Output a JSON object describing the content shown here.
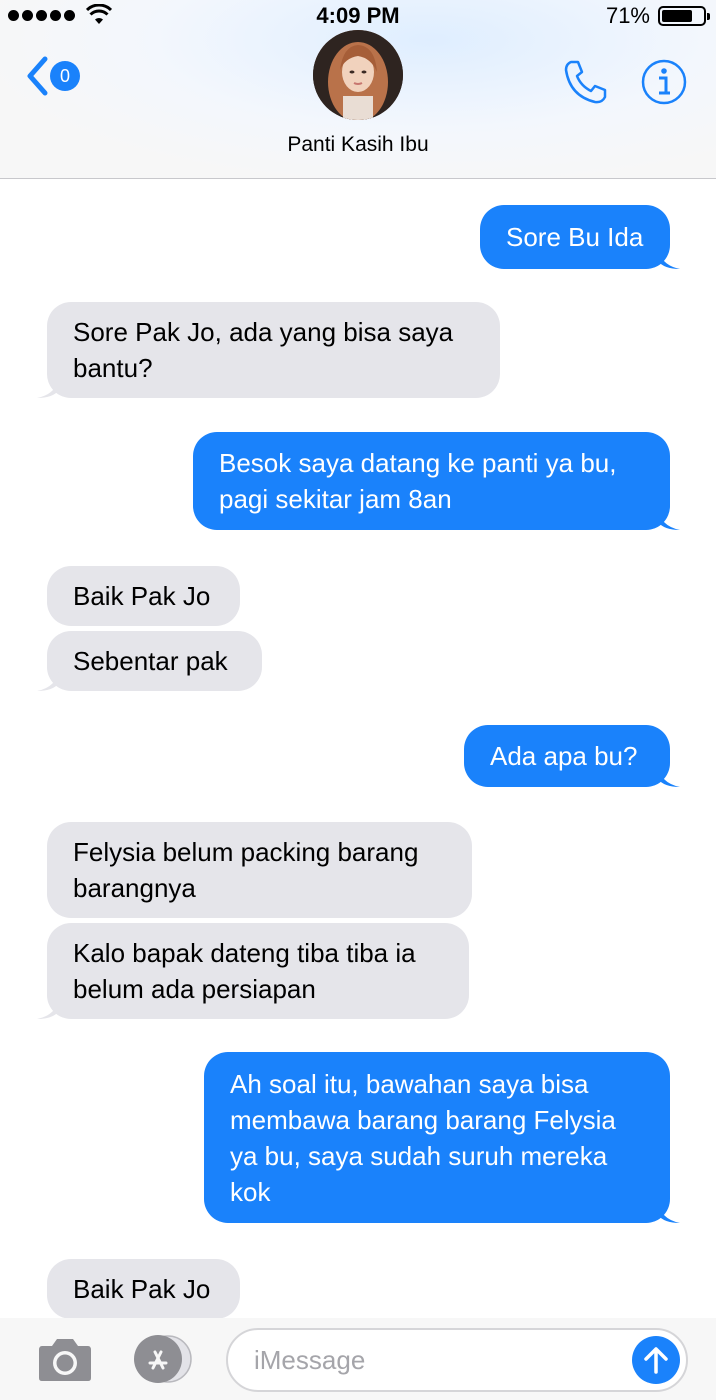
{
  "status": {
    "time": "4:09 PM",
    "battery": "71%"
  },
  "header": {
    "back_count": "0",
    "contact_name": "Panti Kasih Ibu"
  },
  "messages": [
    {
      "dir": "out",
      "text": "Sore Bu Ida"
    },
    {
      "dir": "in",
      "text": "Sore Pak Jo, ada yang bisa saya bantu?"
    },
    {
      "dir": "out",
      "text": "Besok saya datang ke panti ya bu, pagi sekitar jam 8an"
    },
    {
      "dir": "in",
      "text": "Baik Pak Jo"
    },
    {
      "dir": "in",
      "text": "Sebentar pak"
    },
    {
      "dir": "out",
      "text": "Ada apa bu?"
    },
    {
      "dir": "in",
      "text": "Felysia belum packing barang barangnya"
    },
    {
      "dir": "in",
      "text": "Kalo bapak dateng tiba tiba ia belum ada persiapan"
    },
    {
      "dir": "out",
      "text": "Ah soal itu, bawahan saya bisa membawa barang barang Felysia ya bu, saya sudah suruh mereka kok"
    },
    {
      "dir": "in",
      "text": "Baik Pak Jo"
    }
  ],
  "composer": {
    "placeholder": "iMessage",
    "value": ""
  },
  "colors": {
    "accent": "#1a82fb",
    "incoming_bubble": "#e5e5ea"
  }
}
